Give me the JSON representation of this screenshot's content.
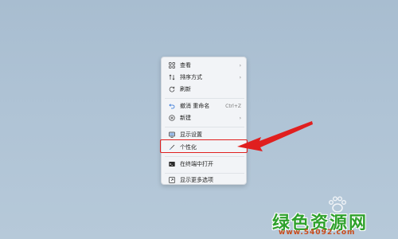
{
  "menu": {
    "items": [
      {
        "label": "查看",
        "icon": "grid-icon",
        "submenu": true
      },
      {
        "label": "排序方式",
        "icon": "sort-icon",
        "submenu": true
      },
      {
        "label": "刷新",
        "icon": "refresh-icon"
      },
      {
        "label": "撤消 重命名",
        "icon": "undo-icon",
        "shortcut": "Ctrl+Z"
      },
      {
        "label": "新建",
        "icon": "plus-circle-icon",
        "submenu": true
      },
      {
        "label": "显示设置",
        "icon": "display-icon"
      },
      {
        "label": "个性化",
        "icon": "brush-icon"
      },
      {
        "label": "在终端中打开",
        "icon": "terminal-icon"
      },
      {
        "label": "显示更多选项",
        "icon": "more-options-icon"
      }
    ]
  },
  "annotation": {
    "highlight_color": "#e01f1f"
  },
  "watermark": {
    "title": "绿色资源网",
    "url": "www.54092.com"
  }
}
